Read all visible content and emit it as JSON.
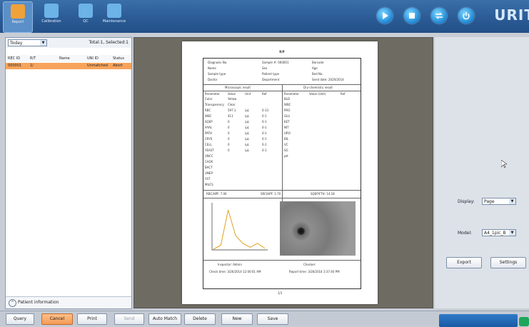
{
  "toolbar": {
    "buttons": [
      {
        "label": "Report",
        "icon": "report-icon",
        "active": true
      },
      {
        "label": "Calibration",
        "icon": "calibration-icon",
        "active": false
      },
      {
        "label": "QC",
        "icon": "qc-icon",
        "active": false
      },
      {
        "label": "Maintenance",
        "icon": "maintenance-icon",
        "active": false
      }
    ],
    "controls": [
      "play-icon",
      "stop-icon",
      "swap-icon",
      "power-icon"
    ],
    "brand": "URIT",
    "colors": {
      "bar": "#2a5a94",
      "control": "#1e88d6",
      "active": "#5b8fc8"
    }
  },
  "sample_list": {
    "filter_value": "Today",
    "total_label": "Total:1, Selected:1",
    "columns": [
      "REC ID",
      "R/T",
      "Name",
      "UNI ID",
      "Status"
    ],
    "rows": [
      {
        "rec_id": "000001",
        "rt": "1/",
        "name": "",
        "uni_id": "Unmatched",
        "status": "Abort"
      }
    ],
    "patient_info_label": "Patient information",
    "selected_row_color": "#f7a35c"
  },
  "report": {
    "title": "R/P",
    "header_fields": [
      [
        "Diagnosis No.",
        "Sample #: 000001",
        "Barcode"
      ],
      [
        "Name",
        "Sex",
        "Age"
      ],
      [
        "Sample type",
        "Patient type",
        "Bed No."
      ],
      [
        "Doctor",
        "Department",
        "Send date: 2020/2014"
      ]
    ],
    "micro_title": "Microscopic result",
    "dry_title": "Dry-chemistry result",
    "micro_header": [
      "Parameter",
      "Value",
      "Unit",
      "Ref"
    ],
    "micro_rows": [
      [
        "Color",
        "Yellow",
        "",
        ""
      ],
      [
        "Transparency",
        "Clear",
        "",
        ""
      ],
      [
        "RBC",
        "597.1",
        "/µL",
        "0-13"
      ],
      [
        "WBC",
        "411",
        "/µL",
        "0-1"
      ],
      [
        "SQEP",
        "0",
        "/µL",
        "0-1"
      ],
      [
        "HYAL",
        "0",
        "/µL",
        "0-1"
      ],
      [
        "PATH",
        "0",
        "/µL",
        "0-1"
      ],
      [
        "CRYS",
        "0",
        "/µL",
        "0-1"
      ],
      [
        "CELL",
        "0",
        "/µL",
        "0-1"
      ],
      [
        "YEAST",
        "0",
        "/µL",
        "0-1"
      ],
      [
        "UNCC",
        "",
        "",
        ""
      ],
      [
        "CAOX",
        "",
        "",
        ""
      ],
      [
        "BACT",
        "",
        "",
        ""
      ],
      [
        "UNEP",
        "",
        "",
        ""
      ],
      [
        "YST",
        "",
        "",
        ""
      ],
      [
        "MUCS",
        "",
        "",
        ""
      ]
    ],
    "dry_header": [
      "Parameter",
      "Value (Unit)",
      "Ref"
    ],
    "dry_rows": [
      [
        "BLD",
        "",
        ""
      ],
      [
        "WBC",
        "",
        ""
      ],
      [
        "PRO",
        "",
        ""
      ],
      [
        "GLU",
        "",
        ""
      ],
      [
        "KET",
        "",
        ""
      ],
      [
        "NIT",
        "",
        ""
      ],
      [
        "URO",
        "",
        ""
      ],
      [
        "BIL",
        "",
        ""
      ],
      [
        "VC",
        "",
        ""
      ],
      [
        "SG",
        "",
        ""
      ],
      [
        "pH",
        "",
        ""
      ]
    ],
    "summary": [
      "RBC/HPF: 7.00",
      "SRC/HPF: 1.70",
      "SQEP/FTH: 14.18"
    ],
    "footer": {
      "inspector": "Inspector: Admin",
      "checker": "Checker:",
      "check_time": "Check time: 3/26/2014 12:00:01 AM",
      "report_time": "Report time: 3/26/2014 3:37:40 PM",
      "page": "1/1"
    },
    "histogram": {
      "x": [
        0,
        1,
        2,
        3,
        4,
        5,
        6,
        7
      ],
      "y": [
        0,
        0.1,
        1.0,
        0.35,
        0.15,
        0.05,
        0.15,
        0.02
      ]
    }
  },
  "settings_panel": {
    "display_label": "Display:",
    "display_value": "Page",
    "model_label": "Model:",
    "model_value": "A4_1pic_B",
    "export_label": "Export",
    "settings_label": "Settings"
  },
  "bottom_buttons": [
    {
      "label": "Query",
      "state": "normal"
    },
    {
      "label": "Cancel",
      "state": "highlight"
    },
    {
      "label": "Print",
      "state": "normal"
    },
    {
      "label": "Send",
      "state": "disabled"
    },
    {
      "label": "Auto Match",
      "state": "normal"
    },
    {
      "label": "Delete",
      "state": "normal"
    },
    {
      "label": "New",
      "state": "normal"
    },
    {
      "label": "Save",
      "state": "normal"
    }
  ]
}
